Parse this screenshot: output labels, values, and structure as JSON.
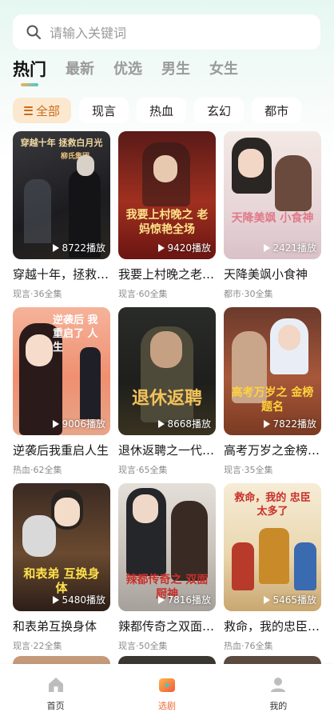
{
  "search": {
    "placeholder": "请输入关键词"
  },
  "tabs": [
    "热门",
    "最新",
    "优选",
    "男生",
    "女生"
  ],
  "chips": [
    "全部",
    "现言",
    "热血",
    "玄幻",
    "都市"
  ],
  "cards": [
    {
      "title": "穿越十年，拯救白月光",
      "meta": "现言·36全集",
      "plays": "8722播放",
      "poster_text": "穿越十年 拯救白月光",
      "poster_sub": "柳氏集团"
    },
    {
      "title": "我要上村晚之老妈惊艳全场",
      "meta": "现言·60全集",
      "plays": "9420播放",
      "poster_text": "我要上村晚之 老妈惊艳全场"
    },
    {
      "title": "天降美飒小食神",
      "meta": "都市·30全集",
      "plays": "2421播放",
      "poster_text": "天降美飒 小食神"
    },
    {
      "title": "逆袭后我重启人生",
      "meta": "热血·62全集",
      "plays": "9006播放",
      "poster_text": "逆袭后 我重启了 人生"
    },
    {
      "title": "退休返聘之一代宗师",
      "meta": "现言·65全集",
      "plays": "8668播放",
      "poster_text": "退休返聘"
    },
    {
      "title": "高考万岁之金榜题名",
      "meta": "现言·35全集",
      "plays": "7822播放",
      "poster_text": "高考万岁之 金榜题名"
    },
    {
      "title": "和表弟互换身体",
      "meta": "现言·22全集",
      "plays": "5480播放",
      "poster_text": "和表弟 互换身体"
    },
    {
      "title": "辣都传奇之双面厨神",
      "meta": "现言·50全集",
      "plays": "7816播放",
      "poster_text": "辣都传奇之 双面厨神"
    },
    {
      "title": "救命，我的忠臣太多了",
      "meta": "热血·76全集",
      "plays": "5465播放",
      "poster_text": "救命，我的 忠臣太多了"
    }
  ],
  "nav": [
    {
      "label": "首页",
      "icon": "home-icon"
    },
    {
      "label": "选剧",
      "icon": "play-box-icon"
    },
    {
      "label": "我的",
      "icon": "user-icon"
    }
  ],
  "colors": {
    "accent": "#f06a3a",
    "chip_active_bg": "#fbe8cf",
    "chip_active_text": "#c96d19"
  }
}
